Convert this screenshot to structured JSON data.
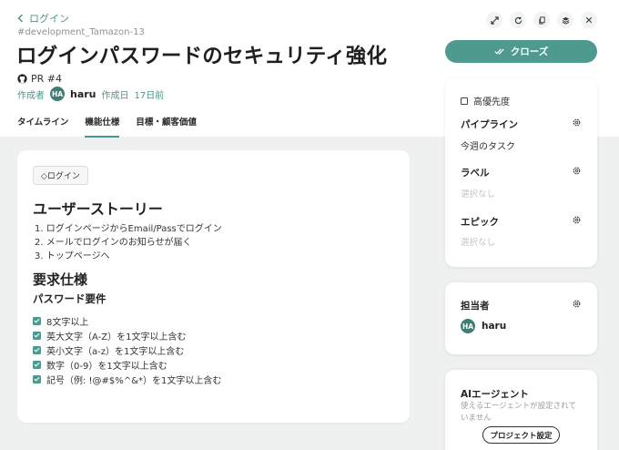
{
  "header": {
    "back_label": "ログイン",
    "repo": "#development_Tamazon-13",
    "title": "ログインパスワードのセキュリティ強化",
    "pr": "PR #4",
    "author_label": "作成者",
    "author_initials": "HA",
    "author_name": "haru",
    "created_label": "作成日",
    "created_value": "17日前"
  },
  "tabs": [
    {
      "label": "タイムライン"
    },
    {
      "label": "機能仕様"
    },
    {
      "label": "目標・顧客価値"
    }
  ],
  "actions": {
    "close_label": "クローズ"
  },
  "content": {
    "chip": "◇ログイン",
    "story_heading": "ユーザーストーリー",
    "story_items": [
      "1. ログインページからEmail/Passでログイン",
      "2. メールでログインのお知らせが届く",
      "3. トップページへ"
    ],
    "req_heading": "要求仕様",
    "pw_heading": "パスワード要件",
    "checks": [
      "8文字以上",
      "英大文字（A-Z）を1文字以上含む",
      "英小文字（a-z）を1文字以上含む",
      "数字（0-9）を1文字以上含む",
      "記号（例: !@#$%^&*）を1文字以上含む"
    ]
  },
  "sidebar": {
    "priority_label": "高優先度",
    "pipeline_title": "パイプライン",
    "pipeline_value": "今週のタスク",
    "label_title": "ラベル",
    "label_empty": "選択なし",
    "epic_title": "エピック",
    "epic_empty": "選択なし",
    "assignee_title": "担当者",
    "assignee_initials": "HA",
    "assignee_name": "haru",
    "ai_title": "AIエージェント",
    "ai_desc": "使えるエージェントが設定されていません",
    "project_settings": "プロジェクト設定"
  },
  "colors": {
    "accent": "#4e9a8f",
    "background": "#eef1f0"
  }
}
